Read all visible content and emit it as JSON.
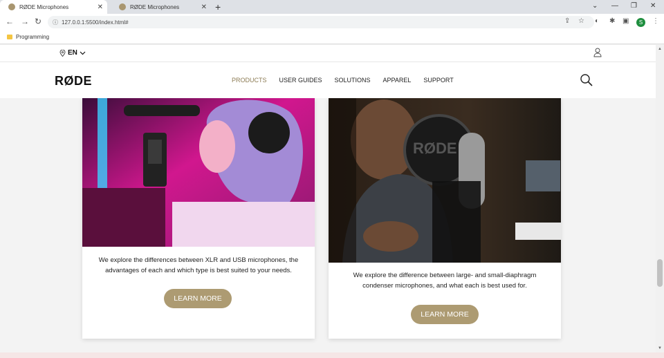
{
  "browser": {
    "tabs": [
      {
        "title": "RØDE Microphones",
        "active": true
      },
      {
        "title": "RØDE Microphones",
        "active": false
      }
    ],
    "new_tab": "+",
    "url": "127.0.0.1:5500/index.html#",
    "bookmark_folder": "Programming",
    "profile_initial": "S"
  },
  "site": {
    "language": "EN",
    "logo": "RØDE",
    "nav": [
      "PRODUCTS",
      "USER GUIDES",
      "SOLUTIONS",
      "APPAREL",
      "SUPPORT"
    ],
    "active_nav": "PRODUCTS",
    "accent_color": "#ad9b72"
  },
  "cards": [
    {
      "image": "woman-with-headphones-and-usb-mic",
      "text": "We explore the differences between XLR and USB microphones, the advantages of each and which type is best suited to your needs.",
      "button": "LEARN MORE"
    },
    {
      "image": "man-singing-into-condenser-mic",
      "text": "We explore the difference between large- and small-diaphragm condenser microphones, and what each is best used for.",
      "button": "LEARN MORE"
    }
  ]
}
